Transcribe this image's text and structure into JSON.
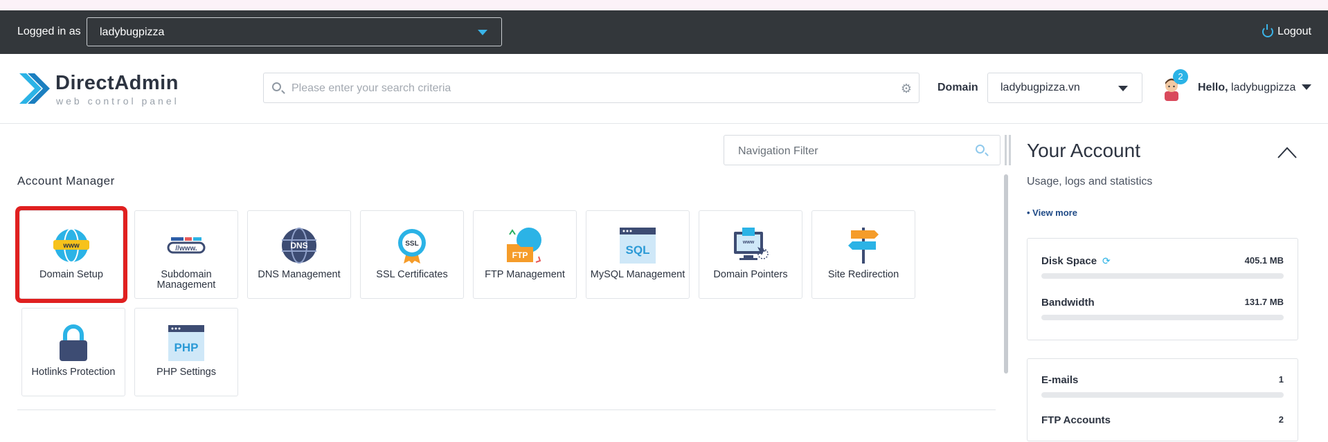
{
  "topbar": {
    "logged_in_label": "Logged in as",
    "account_value": "ladybugpizza",
    "logout_label": "Logout"
  },
  "header": {
    "brand_name": "DirectAdmin",
    "brand_sub": "web control panel",
    "search_placeholder": "Please enter your search criteria",
    "domain_label": "Domain",
    "domain_value": "ladybugpizza.vn",
    "notification_count": "2",
    "hello_label": "Hello,",
    "username": "ladybugpizza"
  },
  "nav_filter": {
    "placeholder": "Navigation Filter"
  },
  "account_manager": {
    "title": "Account Manager",
    "tiles": [
      {
        "label": "Domain Setup",
        "icon": "globe-www-icon"
      },
      {
        "label": "Subdomain Management",
        "icon": "subdomain-www-icon"
      },
      {
        "label": "DNS Management",
        "icon": "dns-globe-icon"
      },
      {
        "label": "SSL Certificates",
        "icon": "ssl-badge-icon"
      },
      {
        "label": "FTP Management",
        "icon": "ftp-folder-icon"
      },
      {
        "label": "MySQL Management",
        "icon": "sql-window-icon"
      },
      {
        "label": "Domain Pointers",
        "icon": "monitor-pointer-icon"
      },
      {
        "label": "Site Redirection",
        "icon": "signpost-icon"
      },
      {
        "label": "Hotlinks Protection",
        "icon": "padlock-icon"
      },
      {
        "label": "PHP Settings",
        "icon": "php-window-icon"
      }
    ]
  },
  "your_account": {
    "title": "Your Account",
    "subtitle": "Usage, logs and statistics",
    "view_more": "• View more",
    "stats": [
      {
        "name": "Disk Space",
        "value": "405.1 MB"
      },
      {
        "name": "Bandwidth",
        "value": "131.7 MB"
      }
    ],
    "stats2": [
      {
        "name": "E-mails",
        "value": "1"
      },
      {
        "name": "FTP Accounts",
        "value": "2"
      }
    ]
  },
  "colors": {
    "accent": "#2bb3e6",
    "topbar": "#33373b",
    "highlight": "#e02020"
  }
}
